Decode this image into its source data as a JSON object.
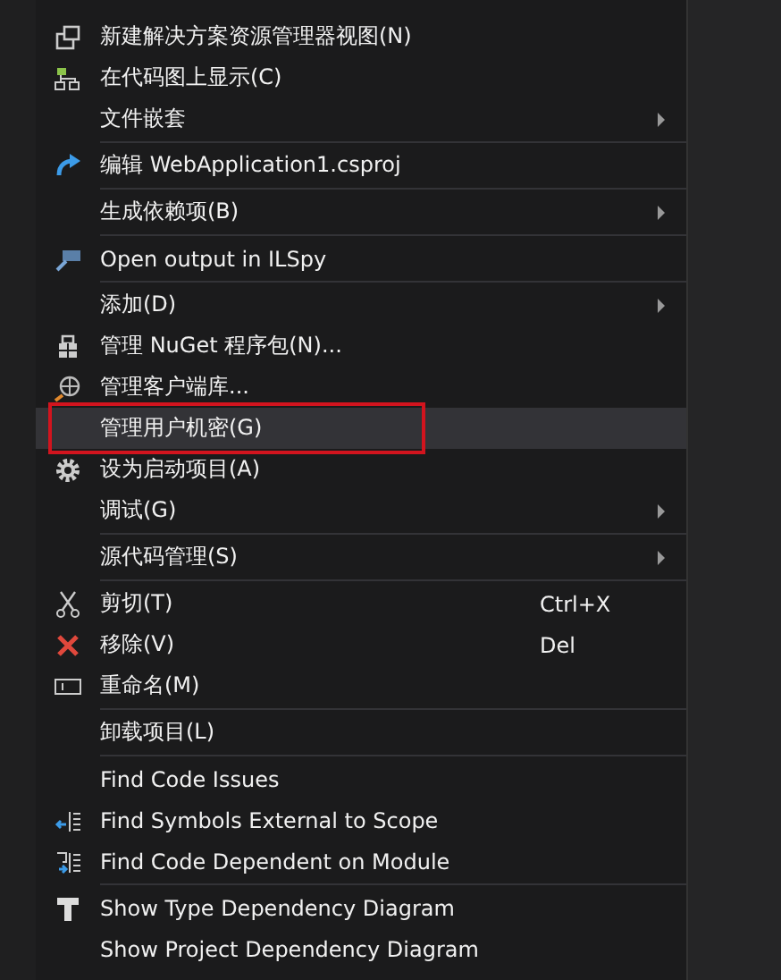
{
  "menu": {
    "items": [
      {
        "kind": "item",
        "label": "新建解决方案资源管理器视图(N)",
        "selected": false
      },
      {
        "kind": "item",
        "label": "在代码图上显示(C)",
        "selected": false
      },
      {
        "kind": "submenu",
        "label": "文件嵌套",
        "selected": false
      },
      {
        "kind": "separator"
      },
      {
        "kind": "item",
        "label": "编辑 WebApplication1.csproj",
        "selected": false
      },
      {
        "kind": "separator"
      },
      {
        "kind": "submenu",
        "label": "生成依赖项(B)",
        "selected": false
      },
      {
        "kind": "separator"
      },
      {
        "kind": "item",
        "label": "Open output in ILSpy",
        "selected": false
      },
      {
        "kind": "separator"
      },
      {
        "kind": "submenu",
        "label": "添加(D)",
        "selected": false
      },
      {
        "kind": "item",
        "label": "管理 NuGet 程序包(N)...",
        "selected": false
      },
      {
        "kind": "item",
        "label": "管理客户端库...",
        "selected": false
      },
      {
        "kind": "item",
        "label": "管理用户机密(G)",
        "selected": true
      },
      {
        "kind": "item",
        "label": "设为启动项目(A)",
        "selected": false
      },
      {
        "kind": "submenu",
        "label": "调试(G)",
        "selected": false
      },
      {
        "kind": "separator"
      },
      {
        "kind": "submenu",
        "label": "源代码管理(S)",
        "selected": false
      },
      {
        "kind": "separator"
      },
      {
        "kind": "item",
        "label": "剪切(T)",
        "shortcut": "Ctrl+X",
        "selected": false
      },
      {
        "kind": "item",
        "label": "移除(V)",
        "shortcut": "Del",
        "selected": false
      },
      {
        "kind": "item",
        "label": "重命名(M)",
        "selected": false
      },
      {
        "kind": "separator"
      },
      {
        "kind": "item",
        "label": "卸载项目(L)",
        "selected": false
      },
      {
        "kind": "separator"
      },
      {
        "kind": "item",
        "label": "Find Code Issues",
        "selected": false
      },
      {
        "kind": "item",
        "label": "Find Symbols External to Scope",
        "selected": false
      },
      {
        "kind": "item",
        "label": "Find Code Dependent on Module",
        "selected": false
      },
      {
        "kind": "separator"
      },
      {
        "kind": "item",
        "label": "Show Type Dependency Diagram",
        "selected": false
      },
      {
        "kind": "item",
        "label": "Show Project Dependency Diagram",
        "selected": false
      }
    ]
  }
}
